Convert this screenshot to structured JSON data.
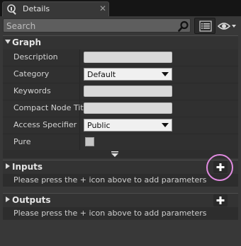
{
  "tab": {
    "title": "Details",
    "close_glyph": "✕",
    "icon": "details-info-icon"
  },
  "search": {
    "placeholder": "Search",
    "value": ""
  },
  "toolbar": {
    "list_view_icon": "list-view-icon",
    "visibility_icon": "eye-icon"
  },
  "graph_section": {
    "title": "Graph",
    "rows": {
      "description": {
        "label": "Description",
        "value": ""
      },
      "category": {
        "label": "Category",
        "value": "Default"
      },
      "keywords": {
        "label": "Keywords",
        "value": ""
      },
      "compact_node_title": {
        "label": "Compact Node Title",
        "value": ""
      },
      "access_specifier": {
        "label": "Access Specifier",
        "value": "Public"
      },
      "pure": {
        "label": "Pure",
        "checked": false
      }
    }
  },
  "inputs_section": {
    "title": "Inputs",
    "hint": "Please press the + icon above to add parameters"
  },
  "outputs_section": {
    "title": "Outputs",
    "hint": "Please press the + icon above to add parameters"
  },
  "colors": {
    "panel_bg": "#383838",
    "field_bg": "#d9d9d9",
    "highlight": "#e08be0"
  }
}
